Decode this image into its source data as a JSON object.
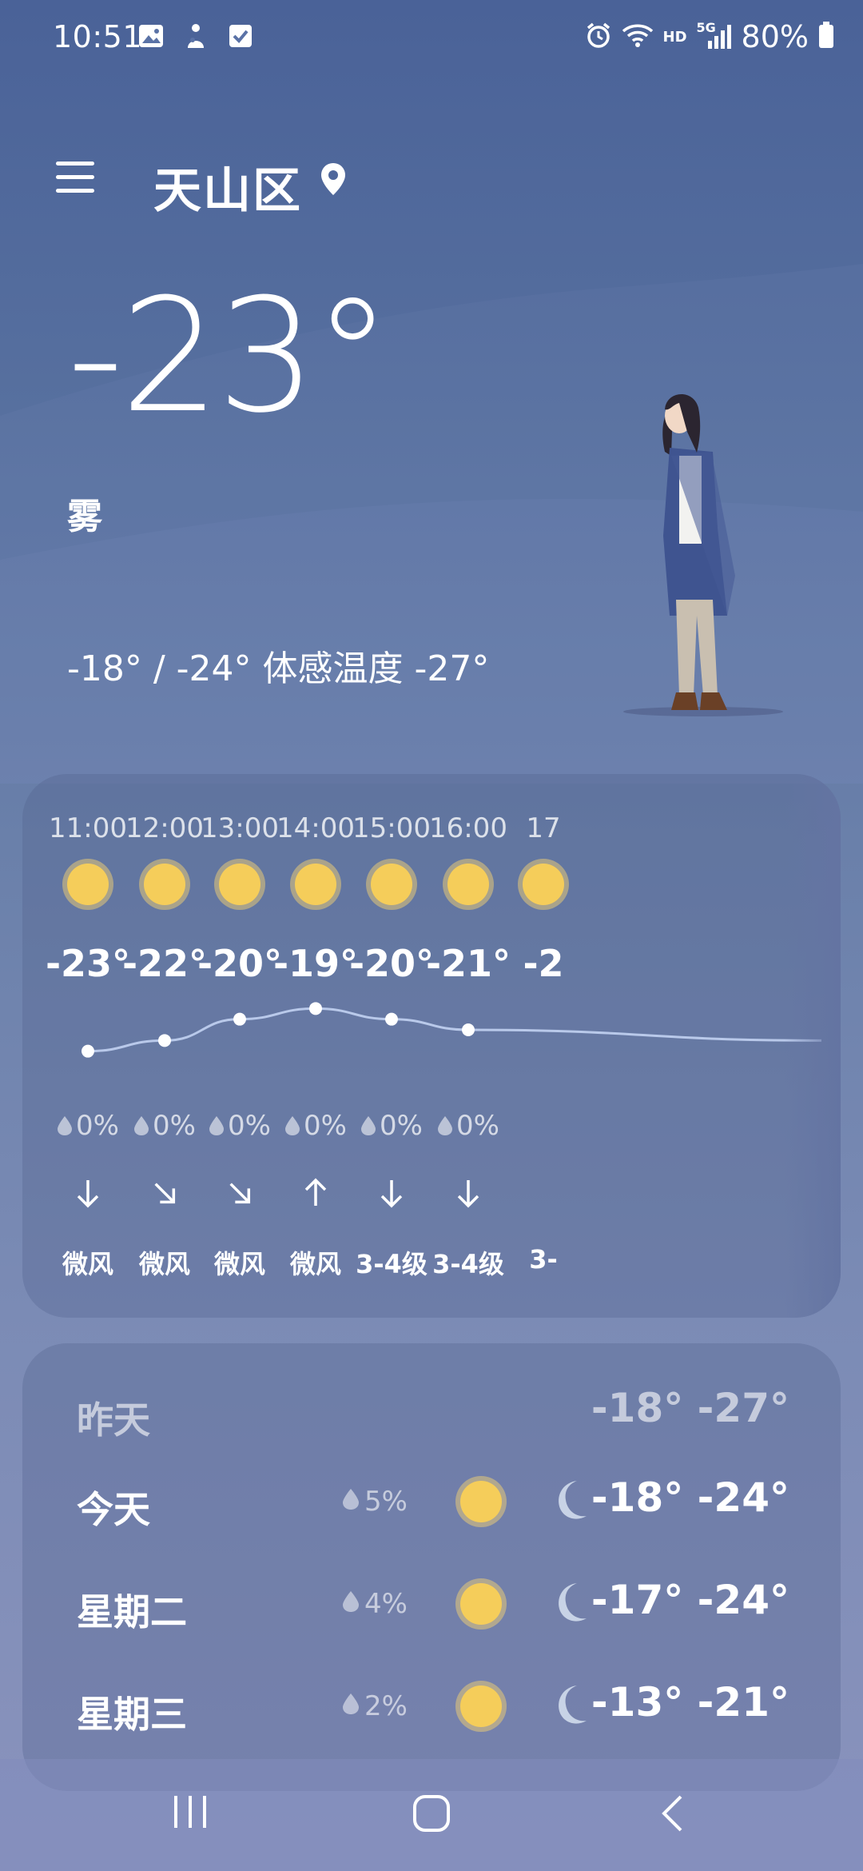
{
  "status": {
    "time": "10:51",
    "battery": "80%",
    "left_icons": [
      "image-icon",
      "person-icon",
      "checkbox-icon"
    ],
    "right_icons": [
      "alarm-icon",
      "wifi-icon",
      "hd-icon",
      "signal-5g-icon",
      "battery-icon"
    ],
    "hd_label": "HD",
    "net_label": "5G"
  },
  "header": {
    "city": "天山区"
  },
  "current": {
    "temp": "-23°",
    "condition": "雾",
    "range": "-18° / -24° 体感温度 -27°"
  },
  "hourly": [
    {
      "time": "11:00",
      "temp": "-23°",
      "precip": "0%",
      "wind": "微风",
      "wind_dir": "S"
    },
    {
      "time": "12:00",
      "temp": "-22°",
      "precip": "0%",
      "wind": "微风",
      "wind_dir": "SE"
    },
    {
      "time": "13:00",
      "temp": "-20°",
      "precip": "0%",
      "wind": "微风",
      "wind_dir": "SE"
    },
    {
      "time": "14:00",
      "temp": "-19°",
      "precip": "0%",
      "wind": "微风",
      "wind_dir": "N"
    },
    {
      "time": "15:00",
      "temp": "-20°",
      "precip": "0%",
      "wind": "3-4级",
      "wind_dir": "S"
    },
    {
      "time": "16:00",
      "temp": "-21°",
      "precip": "0%",
      "wind": "3-4级",
      "wind_dir": "S"
    },
    {
      "time": "17",
      "temp": "-2",
      "precip": "",
      "wind": "3-",
      "wind_dir": ""
    }
  ],
  "hourly_temps_numeric": [
    -23,
    -22,
    -20,
    -19,
    -20,
    -21,
    -22
  ],
  "daily": {
    "yesterday": {
      "label": "昨天",
      "temps": "-18° -27°"
    },
    "rows": [
      {
        "day": "今天",
        "precip": "5%",
        "temps": "-18° -24°"
      },
      {
        "day": "星期二",
        "precip": "4%",
        "temps": "-17° -24°"
      },
      {
        "day": "星期三",
        "precip": "2%",
        "temps": "-13° -21°"
      }
    ]
  },
  "colors": {
    "sun": "#f5cd5a",
    "moon": "#c8d3e6",
    "curve": "#b9c9ea"
  }
}
